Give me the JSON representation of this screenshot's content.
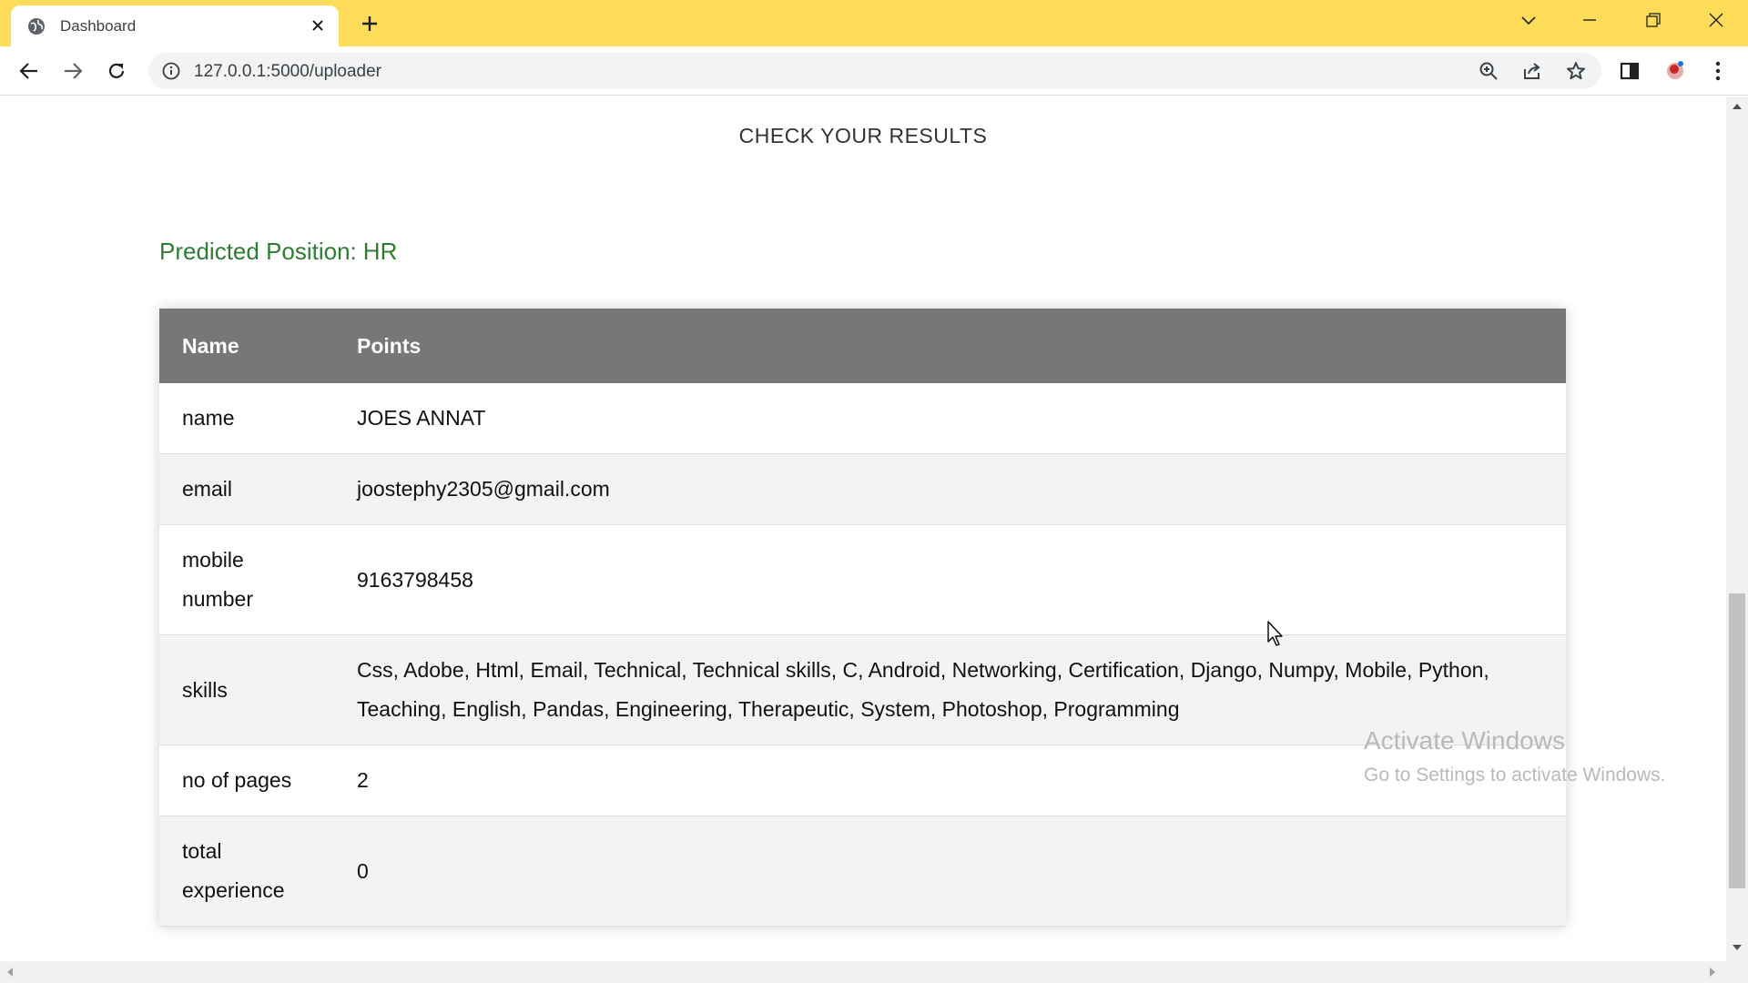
{
  "browser": {
    "tab": {
      "title": "Dashboard"
    },
    "address": {
      "url": "127.0.0.1:5000/uploader"
    }
  },
  "page": {
    "heading": "CHECK YOUR RESULTS",
    "predicted": {
      "label": "Predicted Position:",
      "value": "HR",
      "color": "#2e7d32"
    },
    "table": {
      "headers": [
        "Name",
        "Points"
      ],
      "rows": [
        {
          "key": "name",
          "value": "JOES ANNAT"
        },
        {
          "key": "email",
          "value": "joostephy2305@gmail.com"
        },
        {
          "key": "mobile number",
          "value": "9163798458"
        },
        {
          "key": "skills",
          "value": "Css, Adobe, Html, Email, Technical, Technical skills, C, Android, Networking, Certification, Django, Numpy, Mobile, Python, Teaching, English, Pandas, Engineering, Therapeutic, System, Photoshop, Programming"
        },
        {
          "key": "no of pages",
          "value": "2"
        },
        {
          "key": "total experience",
          "value": "0"
        }
      ]
    }
  },
  "overlay": {
    "watermark_title": "Activate Windows",
    "watermark_subtitle": "Go to Settings to activate Windows."
  },
  "colors": {
    "tabstrip": "#fedc5a",
    "table_header": "#777777",
    "accent_green": "#2e7d32"
  },
  "icons": [
    "globe-icon",
    "close-icon",
    "plus-icon",
    "chevron-down-icon",
    "minimize-icon",
    "restore-icon",
    "window-close-icon",
    "back-arrow-icon",
    "forward-arrow-icon",
    "reload-icon",
    "info-icon",
    "zoom-icon",
    "share-icon",
    "star-icon",
    "side-panel-icon",
    "profile-icon",
    "kebab-menu-icon",
    "mouse-cursor-icon"
  ]
}
